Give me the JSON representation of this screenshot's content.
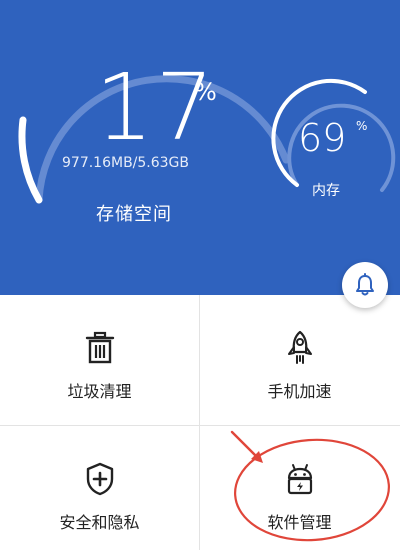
{
  "storage": {
    "percent": "17",
    "percent_sign": "%",
    "detail": "977.16MB/5.63GB",
    "title": "存储空间",
    "value": 17
  },
  "memory": {
    "percent": "69",
    "percent_sign": "%",
    "title": "内存",
    "value": 69
  },
  "actions": {
    "bell": "bell-icon"
  },
  "tiles": [
    {
      "label": "垃圾清理",
      "icon": "trash-icon"
    },
    {
      "label": "手机加速",
      "icon": "rocket-icon"
    },
    {
      "label": "安全和隐私",
      "icon": "shield-icon"
    },
    {
      "label": "软件管理",
      "icon": "android-bag-icon"
    }
  ],
  "colors": {
    "header_bg": "#2f62be",
    "ring": "#ffffff",
    "ring_track": "#6f93d6",
    "annotation": "#e0463a"
  }
}
